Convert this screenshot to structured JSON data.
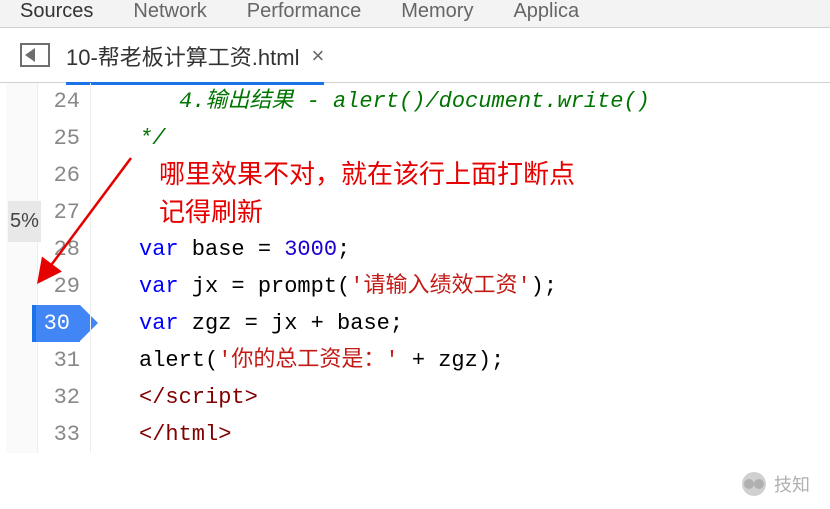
{
  "devtools_tabs": {
    "sources": "Sources",
    "network": "Network",
    "performance": "Performance",
    "memory": "Memory",
    "application": "Applica"
  },
  "file_tab": {
    "name": "10-帮老板计算工资.html",
    "close": "×"
  },
  "left_label": "5%",
  "lines": {
    "l24": {
      "num": "24",
      "comment": "4.输出结果 - alert()/document.write()"
    },
    "l25": {
      "num": "25",
      "comment": "*/"
    },
    "l26": {
      "num": "26"
    },
    "l27": {
      "num": "27"
    },
    "l28": {
      "num": "28",
      "kw": "var",
      "text1": " base = ",
      "val": "3000",
      "text2": ";"
    },
    "l29": {
      "num": "29",
      "kw": "var",
      "text1": " jx = prompt(",
      "str": "'请输入绩效工资'",
      "text2": ");"
    },
    "l30": {
      "num": "30",
      "kw": "var",
      "text1": " zgz = jx + base;"
    },
    "l31": {
      "num": "31",
      "text1": "alert(",
      "str": "'你的总工资是：'",
      "text2": " + zgz);"
    },
    "l32": {
      "num": "32",
      "tag_open": "</",
      "tag_name": "script",
      "tag_close": ">"
    },
    "l33": {
      "num": "33",
      "tag_open": "</",
      "tag_name": "html",
      "tag_close": ">"
    }
  },
  "annotation": {
    "line1": "哪里效果不对，就在该行上面打断点",
    "line2": "记得刷新"
  },
  "watermark": "技知"
}
